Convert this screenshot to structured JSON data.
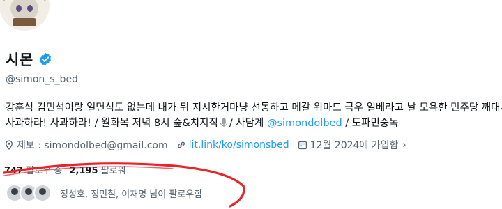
{
  "profile": {
    "display_name": "시몬",
    "handle": "@simon_s_bed",
    "verified_icon": "verified-badge-icon",
    "accent_color": "#1d9bf0"
  },
  "bio": {
    "line1": "강훈식 김민석이랑 일면식도 없는데 내가 뭐 지시한거마냥 선동하고 메갈 워마드 극우 일베라고 날 모욕한 민주당 깨대시는",
    "line2_a": "사과하라! 사과하라! / 월화목 저녁 8시 숲&치지직",
    "line2_b": "/ 사담계",
    "mention": "@simondolbed",
    "line2_c": "/ 도파민중독"
  },
  "meta": {
    "email": "제보 : simondolbed@gmail.com",
    "link": "lit.link/ko/simonsbed",
    "joined": "12월 2024에 가입함",
    "chevron": "›"
  },
  "counts": {
    "following_count": "747",
    "following_label": "팔로우 중",
    "followers_count": "2,195",
    "followers_label": "팔로워"
  },
  "followed_by": {
    "text": "정성호, 정민철, 이재명 님이 팔로우함",
    "avatars": [
      "avatar-1",
      "avatar-2",
      "avatar-3"
    ]
  }
}
